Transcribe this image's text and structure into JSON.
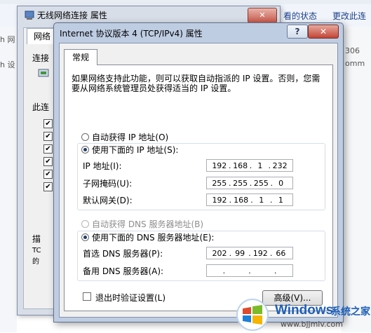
{
  "background": {
    "top_links": [
      "看的状态",
      "更改此连接"
    ],
    "left_fragments": [
      "h 网",
      "h 设"
    ],
    "right_fragments": [
      "306",
      "omm"
    ]
  },
  "back_dialog": {
    "title": "无线网络连接 属性",
    "close_label": "✕",
    "tab_label": "网络",
    "connect_label": "连接",
    "items_label": "此连",
    "desc_label": "描",
    "desc_text_1": "TC",
    "desc_text_2": "的"
  },
  "dialog": {
    "title": "Internet 协议版本 4 (TCP/IPv4) 属性",
    "help_label": "?",
    "close_label": "✕",
    "tab_label": "常规",
    "description": "如果网络支持此功能，则可以获取自动指派的 IP 设置。否则，您需要从网络系统管理员处获得适当的 IP 设置。",
    "auto_ip_label": "自动获得 IP 地址(O)",
    "manual_ip_label": "使用下面的 IP 地址(S):",
    "ip_label": "IP 地址(I):",
    "ip_value": [
      "192",
      "168",
      "1",
      "232"
    ],
    "mask_label": "子网掩码(U):",
    "mask_value": [
      "255",
      "255",
      "255",
      "0"
    ],
    "gateway_label": "默认网关(D):",
    "gateway_value": [
      "192",
      "168",
      "1",
      "1"
    ],
    "auto_dns_label": "自动获得 DNS 服务器地址(B)",
    "manual_dns_label": "使用下面的 DNS 服务器地址(E):",
    "pref_dns_label": "首选 DNS 服务器(P):",
    "pref_dns_value": [
      "202",
      "99",
      "192",
      "66"
    ],
    "alt_dns_label": "备用 DNS 服务器(A):",
    "alt_dns_value": [
      ".",
      ".",
      "."
    ],
    "validate_label": "退出时验证设置(L)",
    "advanced_label": "高级(V)..."
  },
  "watermark": {
    "brand": "Windows",
    "sub": "系统之家",
    "url": "www.bjjmlv.com"
  }
}
